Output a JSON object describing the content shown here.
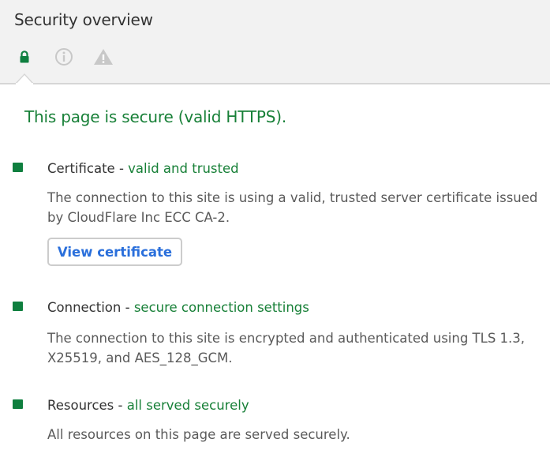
{
  "header": {
    "title": "Security overview",
    "tabs": [
      {
        "name": "security",
        "icon": "lock-icon",
        "color": "#0f7f3f",
        "selected": true
      },
      {
        "name": "info",
        "icon": "info-icon",
        "color": "#c8c8c8",
        "selected": false
      },
      {
        "name": "warning",
        "icon": "warning-icon",
        "color": "#c8c8c8",
        "selected": false
      }
    ]
  },
  "summary": "This page is secure (valid HTTPS).",
  "colors": {
    "secure": "#188038",
    "bullet": "#0f7f3f",
    "link": "#2a6fdb"
  },
  "items": [
    {
      "label": "Certificate",
      "separator": " - ",
      "status": "valid and trusted",
      "description": "The connection to this site is using a valid, trusted server certificate issued by CloudFlare Inc ECC CA-2.",
      "button": "View certificate"
    },
    {
      "label": "Connection",
      "separator": " - ",
      "status": "secure connection settings",
      "description": "The connection to this site is encrypted and authenticated using TLS 1.3, X25519, and AES_128_GCM."
    },
    {
      "label": "Resources",
      "separator": " - ",
      "status": "all served securely",
      "description": "All resources on this page are served securely."
    }
  ]
}
